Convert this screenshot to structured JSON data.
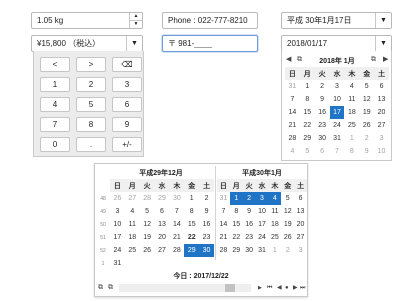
{
  "inputs": {
    "number": {
      "value": "1.05 kg",
      "spin_up": "▲",
      "spin_down": "▼"
    },
    "phone": {
      "value": "Phone : 022-777-8210"
    },
    "era_date": {
      "value": "平成 30年1月17日",
      "dropdown": "▼"
    },
    "currency": {
      "value": "¥15,800 （税込）",
      "dropdown": "▼"
    },
    "postal": {
      "prefix": "〒",
      "value": "981-",
      "placeholder": "____"
    },
    "date": {
      "value": "2018/01/17",
      "dropdown": "▼"
    }
  },
  "calculator": {
    "rows": [
      [
        "<",
        ">",
        "⌫"
      ],
      [
        "1",
        "2",
        "3"
      ],
      [
        "4",
        "5",
        "6"
      ],
      [
        "7",
        "8",
        "9"
      ],
      [
        "0",
        ".",
        "+/-"
      ]
    ]
  },
  "small_calendar": {
    "title": "2018年 1月",
    "weekdays": [
      "日",
      "月",
      "火",
      "水",
      "木",
      "金",
      "土"
    ],
    "days": [
      [
        "31",
        "1",
        "2",
        "3",
        "4",
        "5",
        "6"
      ],
      [
        "7",
        "8",
        "9",
        "10",
        "11",
        "12",
        "13"
      ],
      [
        "14",
        "15",
        "16",
        "17",
        "18",
        "19",
        "20"
      ],
      [
        "21",
        "22",
        "23",
        "24",
        "25",
        "26",
        "27"
      ],
      [
        "28",
        "29",
        "30",
        "31",
        "1",
        "2",
        "3"
      ],
      [
        "4",
        "5",
        "6",
        "7",
        "8",
        "9",
        "10"
      ]
    ],
    "other_month": [
      [
        0,
        0
      ],
      [
        4,
        4
      ],
      [
        4,
        5
      ],
      [
        4,
        6
      ],
      [
        5,
        0
      ],
      [
        5,
        1
      ],
      [
        5,
        2
      ],
      [
        5,
        3
      ],
      [
        5,
        4
      ],
      [
        5,
        5
      ],
      [
        5,
        6
      ]
    ],
    "selected": [
      [
        2,
        3
      ]
    ],
    "nav": {
      "prev": "◀",
      "today_icon": "⧉",
      "copy_icon": "⧉",
      "next": "▶"
    }
  },
  "big_calendar": {
    "left": {
      "title": "平成29年12月",
      "weekdays": [
        "日",
        "月",
        "火",
        "水",
        "木",
        "金",
        "土"
      ],
      "week_numbers": [
        "48",
        "49",
        "50",
        "51",
        "52",
        "1"
      ],
      "days": [
        [
          "26",
          "27",
          "28",
          "29",
          "30",
          "1",
          "2"
        ],
        [
          "3",
          "4",
          "5",
          "6",
          "7",
          "8",
          "9"
        ],
        [
          "10",
          "11",
          "12",
          "13",
          "14",
          "15",
          "16"
        ],
        [
          "17",
          "18",
          "19",
          "20",
          "21",
          "22",
          "23"
        ],
        [
          "24",
          "25",
          "26",
          "27",
          "28",
          "29",
          "30"
        ],
        [
          "31",
          "1",
          "2",
          "3",
          "4",
          "5",
          "6"
        ]
      ],
      "other_month": [
        [
          0,
          0
        ],
        [
          0,
          1
        ],
        [
          0,
          2
        ],
        [
          0,
          3
        ],
        [
          0,
          4
        ]
      ],
      "hidden": [
        [
          5,
          1
        ],
        [
          5,
          2
        ],
        [
          5,
          3
        ],
        [
          5,
          4
        ],
        [
          5,
          5
        ],
        [
          5,
          6
        ]
      ],
      "selected": [
        [
          4,
          5
        ],
        [
          4,
          6
        ]
      ],
      "today": [
        [
          3,
          5
        ]
      ]
    },
    "right": {
      "title": "平成30年1月",
      "weekdays": [
        "日",
        "月",
        "火",
        "水",
        "木",
        "金",
        "土"
      ],
      "days": [
        [
          "31",
          "1",
          "2",
          "3",
          "4",
          "5",
          "6"
        ],
        [
          "7",
          "8",
          "9",
          "10",
          "11",
          "12",
          "13"
        ],
        [
          "14",
          "15",
          "16",
          "17",
          "18",
          "19",
          "20"
        ],
        [
          "21",
          "22",
          "23",
          "24",
          "25",
          "26",
          "27"
        ],
        [
          "28",
          "29",
          "30",
          "31",
          "1",
          "2",
          "3"
        ],
        [
          "4",
          "5",
          "6",
          "7",
          "8",
          "9",
          "10"
        ]
      ],
      "other_month": [
        [
          0,
          0
        ],
        [
          4,
          4
        ],
        [
          4,
          5
        ],
        [
          4,
          6
        ]
      ],
      "hidden": [
        [
          5,
          0
        ],
        [
          5,
          1
        ],
        [
          5,
          2
        ],
        [
          5,
          3
        ],
        [
          5,
          4
        ],
        [
          5,
          5
        ],
        [
          5,
          6
        ]
      ],
      "selected": [
        [
          0,
          1
        ],
        [
          0,
          2
        ],
        [
          0,
          3
        ],
        [
          0,
          4
        ]
      ],
      "today": []
    },
    "today_label": "今日 : 2017/12/22",
    "footer": {
      "icon1": "⧉",
      "icon2": "⧉",
      "scroll_left": "◀",
      "scroll_right": "▶",
      "first": "⏮",
      "prev": "◀",
      "dot": "●",
      "next": "▶",
      "last": "⏭"
    },
    "scroll_position": 0.87
  },
  "colors": {
    "accent": "#1f74c6",
    "border": "#b9b9b9",
    "panel": "#ececec"
  }
}
